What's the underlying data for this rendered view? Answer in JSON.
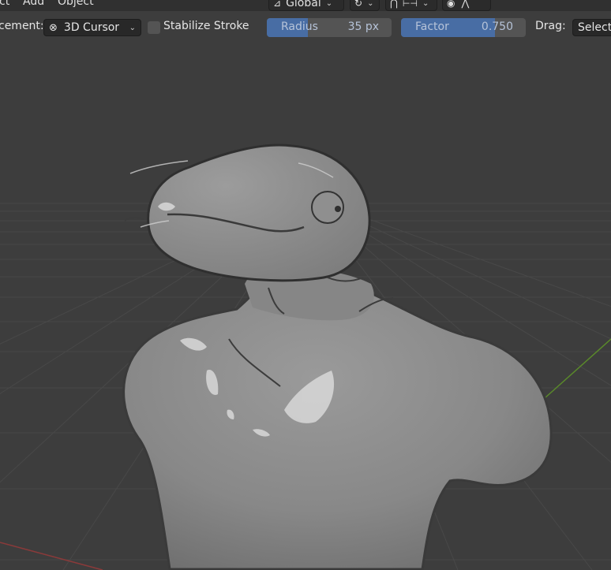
{
  "menu": {
    "item_partial": "ct",
    "add": "Add",
    "object": "Object"
  },
  "header": {
    "orientation": "Global",
    "snap_chevron": "⌄",
    "proportional_icon": "proportional-edit-icon"
  },
  "toolbar": {
    "placement_label": "cement:",
    "placement_value": "3D Cursor",
    "stabilize_label": "Stabilize Stroke",
    "stabilize_checked": false,
    "radius_label": "Radius",
    "radius_value": "35 px",
    "radius_fraction": 0.33,
    "factor_label": "Factor",
    "factor_value": "0.750",
    "factor_fraction": 0.75,
    "drag_label": "Drag:",
    "drag_value": "Select"
  },
  "colors": {
    "viewport_bg": "#3d3d3d",
    "slider_fill": "#4772b3",
    "axis_green": "#5a8a2a",
    "axis_red": "#8a3a3a",
    "model_gray": "#8a8a8a"
  }
}
